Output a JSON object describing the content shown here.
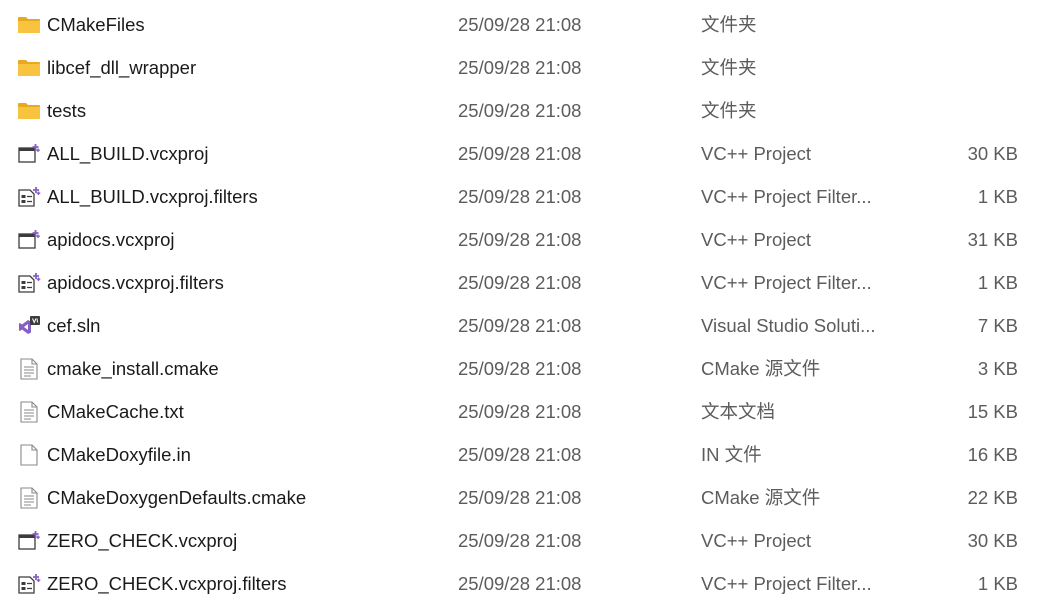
{
  "files": [
    {
      "name": "CMakeFiles",
      "date": "25/09/28 21:08",
      "type": "文件夹",
      "size": "",
      "icon": "folder-icon"
    },
    {
      "name": "libcef_dll_wrapper",
      "date": "25/09/28 21:08",
      "type": "文件夹",
      "size": "",
      "icon": "folder-icon"
    },
    {
      "name": "tests",
      "date": "25/09/28 21:08",
      "type": "文件夹",
      "size": "",
      "icon": "folder-icon"
    },
    {
      "name": "ALL_BUILD.vcxproj",
      "date": "25/09/28 21:08",
      "type": "VC++ Project",
      "size": "30 KB",
      "icon": "vcxproj-icon"
    },
    {
      "name": "ALL_BUILD.vcxproj.filters",
      "date": "25/09/28 21:08",
      "type": "VC++ Project Filter...",
      "size": "1 KB",
      "icon": "vcxproj-filters-icon"
    },
    {
      "name": "apidocs.vcxproj",
      "date": "25/09/28 21:08",
      "type": "VC++ Project",
      "size": "31 KB",
      "icon": "vcxproj-icon"
    },
    {
      "name": "apidocs.vcxproj.filters",
      "date": "25/09/28 21:08",
      "type": "VC++ Project Filter...",
      "size": "1 KB",
      "icon": "vcxproj-filters-icon"
    },
    {
      "name": "cef.sln",
      "date": "25/09/28 21:08",
      "type": "Visual Studio Soluti...",
      "size": "7 KB",
      "icon": "visual-studio-solution-icon"
    },
    {
      "name": "cmake_install.cmake",
      "date": "25/09/28 21:08",
      "type": "CMake 源文件",
      "size": "3 KB",
      "icon": "text-document-icon"
    },
    {
      "name": "CMakeCache.txt",
      "date": "25/09/28 21:08",
      "type": "文本文档",
      "size": "15 KB",
      "icon": "text-document-icon"
    },
    {
      "name": "CMakeDoxyfile.in",
      "date": "25/09/28 21:08",
      "type": "IN 文件",
      "size": "16 KB",
      "icon": "blank-file-icon"
    },
    {
      "name": "CMakeDoxygenDefaults.cmake",
      "date": "25/09/28 21:08",
      "type": "CMake 源文件",
      "size": "22 KB",
      "icon": "text-document-icon"
    },
    {
      "name": "ZERO_CHECK.vcxproj",
      "date": "25/09/28 21:08",
      "type": "VC++ Project",
      "size": "30 KB",
      "icon": "vcxproj-icon"
    },
    {
      "name": "ZERO_CHECK.vcxproj.filters",
      "date": "25/09/28 21:08",
      "type": "VC++ Project Filter...",
      "size": "1 KB",
      "icon": "vcxproj-filters-icon"
    }
  ],
  "colors": {
    "folder": "#f8c440",
    "folder_dark": "#e8a820",
    "vs_purple": "#865fc5",
    "text_primary": "#1a1a1a",
    "text_secondary": "#5c5c5c"
  }
}
